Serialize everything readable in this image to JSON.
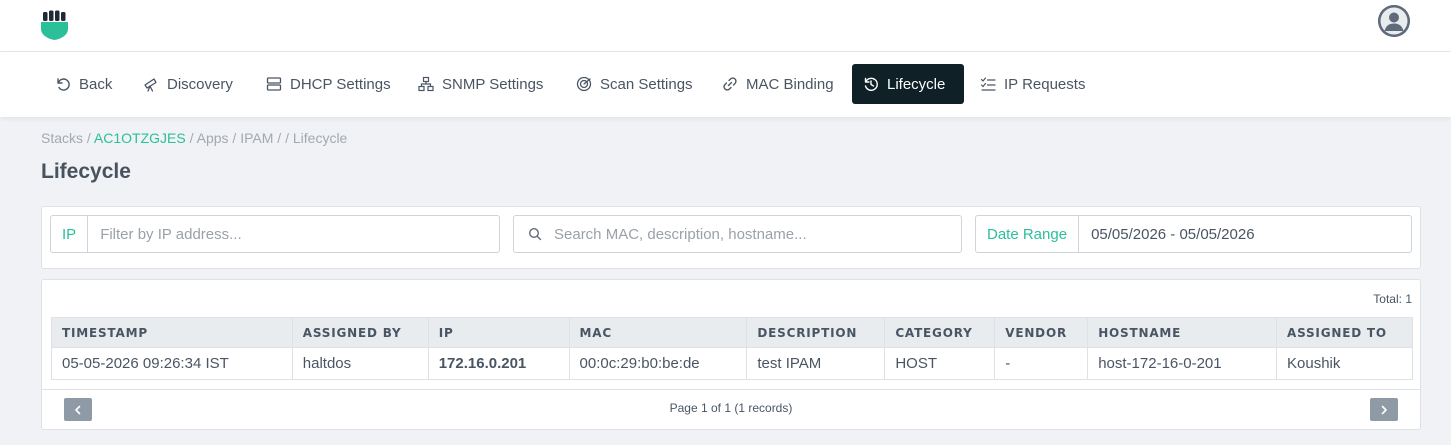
{
  "colors": {
    "accent": "#2bbf9a",
    "nav_active_bg": "#102027",
    "pagination_button": "#8e9aa6"
  },
  "header": {
    "logo_icon": "fist-shield-logo",
    "avatar_icon": "user-avatar-icon"
  },
  "nav": {
    "items": [
      {
        "label": "Back",
        "icon": "back-arrow-icon",
        "active": false
      },
      {
        "label": "Discovery",
        "icon": "telescope-icon",
        "active": false
      },
      {
        "label": "DHCP Settings",
        "icon": "server-icon",
        "active": false
      },
      {
        "label": "SNMP Settings",
        "icon": "network-icon",
        "active": false
      },
      {
        "label": "Scan Settings",
        "icon": "radar-icon",
        "active": false
      },
      {
        "label": "MAC Binding",
        "icon": "link-icon",
        "active": false
      },
      {
        "label": "Lifecycle",
        "icon": "history-icon",
        "active": true
      },
      {
        "label": "IP Requests",
        "icon": "checklist-icon",
        "active": false
      }
    ]
  },
  "breadcrumb": {
    "stacks": "Stacks",
    "sep": " / ",
    "stack_id": "AC1OTZGJES",
    "apps": "Apps",
    "ipam": "IPAM",
    "empty_sep": " / / ",
    "current": "Lifecycle"
  },
  "page": {
    "title": "Lifecycle"
  },
  "filters": {
    "ip_addon": "IP",
    "ip_placeholder": "Filter by IP address...",
    "search_placeholder": "Search MAC, description, hostname...",
    "date_addon": "Date Range",
    "date_value": "05/05/2026 - 05/05/2026"
  },
  "table": {
    "total": "Total: 1",
    "columns": [
      "TIMESTAMP",
      "ASSIGNED BY",
      "IP",
      "MAC",
      "DESCRIPTION",
      "CATEGORY",
      "VENDOR",
      "HOSTNAME",
      "ASSIGNED TO"
    ],
    "rows": [
      [
        "05-05-2026 09:26:34 IST",
        "haltdos",
        "172.16.0.201",
        "00:0c:29:b0:be:de",
        "test IPAM",
        "HOST",
        "-",
        "host-172-16-0-201",
        "Koushik"
      ]
    ]
  },
  "pagination": {
    "text": "Page 1 of 1 (1 records)",
    "prev_icon": "chevron-left-icon",
    "next_icon": "chevron-right-icon"
  }
}
